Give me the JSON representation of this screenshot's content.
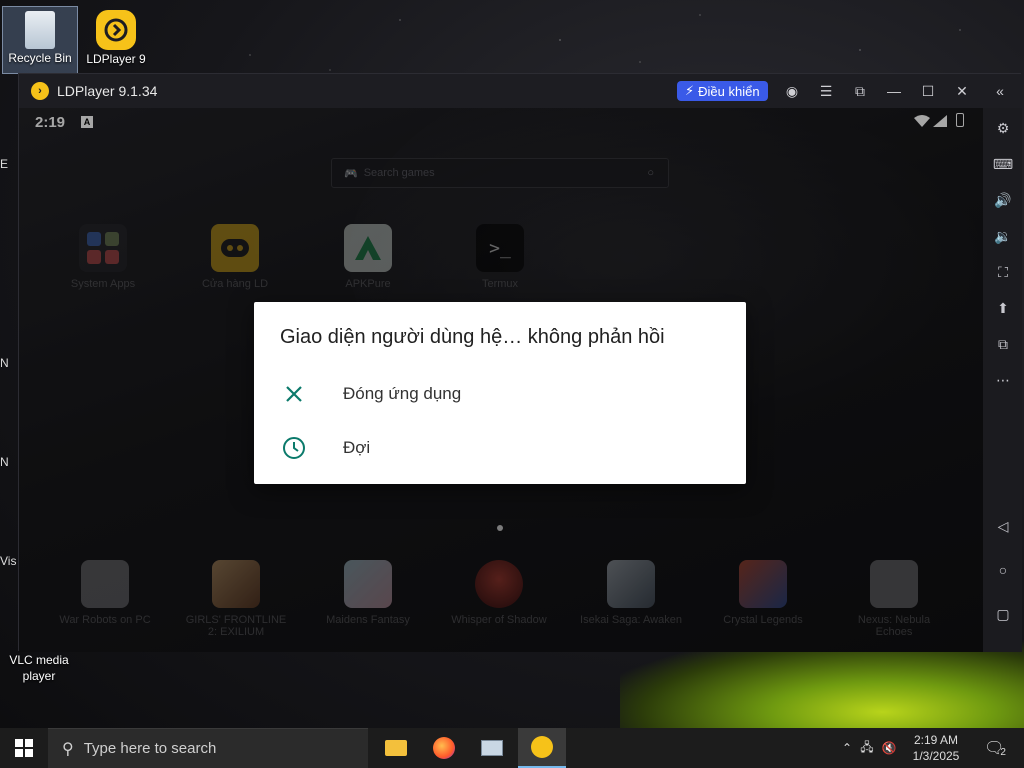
{
  "desktop": {
    "icons": [
      {
        "label": "Recycle Bin"
      },
      {
        "label": "LDPlayer 9"
      },
      {
        "label": "VLC media player"
      }
    ],
    "left_strip_letters": [
      "E",
      "N",
      "N",
      "Vis"
    ]
  },
  "window": {
    "title": "LDPlayer 9.1.34",
    "control_button": "Điều khiển"
  },
  "android": {
    "time": "2:19",
    "search_placeholder": "Search games",
    "apps_top": [
      "System Apps",
      "Cửa hàng LD",
      "APKPure",
      "Termux"
    ],
    "apps_bottom": [
      "War Robots on PC",
      "GIRLS' FRONTLINE 2: EXILIUM",
      "Maidens Fantasy",
      "Whisper of Shadow",
      "Isekai Saga: Awaken",
      "Crystal Legends",
      "Nexus: Nebula Echoes"
    ]
  },
  "dialog": {
    "title": "Giao diện người dùng hệ… không phản hồi",
    "options": [
      {
        "label": "Đóng ứng dụng",
        "icon": "close-icon"
      },
      {
        "label": "Đợi",
        "icon": "clock-icon"
      }
    ],
    "accent": "#0b7a6b"
  },
  "taskbar": {
    "search_placeholder": "Type here to search",
    "time": "2:19 AM",
    "date": "1/3/2025",
    "notification_count": "2"
  }
}
